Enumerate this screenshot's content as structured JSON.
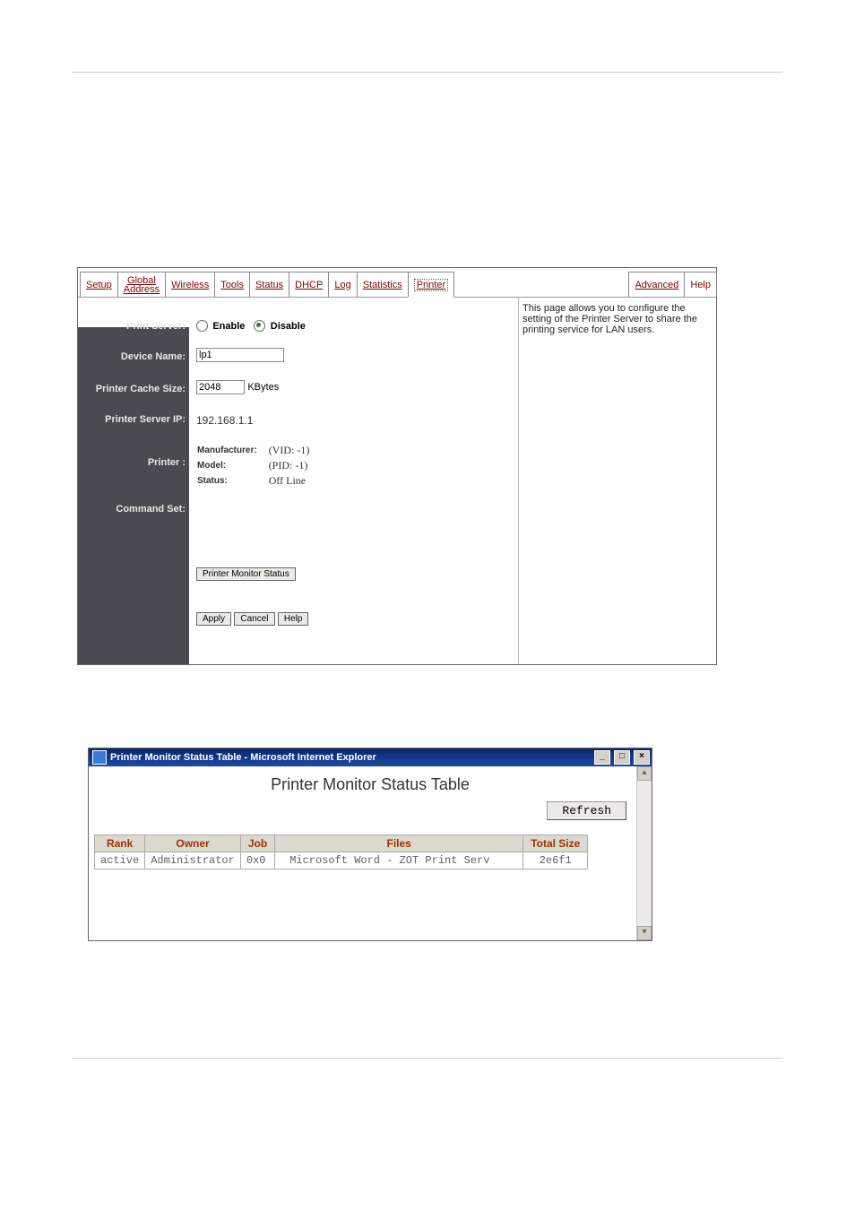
{
  "tabs": {
    "setup": "Setup",
    "global_address_top": "Global",
    "global_address_bot": "Address",
    "wireless": "Wireless",
    "tools": "Tools",
    "status": "Status",
    "dhcp": "DHCP",
    "log": "Log",
    "statistics": "Statistics",
    "printer": "Printer",
    "advanced": "Advanced",
    "help": "Help"
  },
  "side_help": "This page allows you to configure the setting of the Printer Server to share the printing service for LAN users.",
  "labels": {
    "print_server": "Print Server:",
    "device_name": "Device Name:",
    "printer_cache_size": "Printer Cache Size:",
    "printer_server_ip": "Printer Server IP:",
    "printer": "Printer :",
    "command_set": "Command Set:"
  },
  "values": {
    "enable": "Enable",
    "disable": "Disable",
    "device_name_val": "lp1",
    "cache_size_val": "2048",
    "cache_size_unit": "KBytes",
    "server_ip": "192.168.1.1",
    "manufacturer_label": "Manufacturer:",
    "manufacturer_val": "(VID: -1)",
    "model_label": "Model:",
    "model_val": "(PID: -1)",
    "status_label": "Status:",
    "status_val": "Off Line"
  },
  "buttons": {
    "printer_monitor_status": "Printer Monitor Status",
    "apply": "Apply",
    "cancel": "Cancel",
    "help": "Help"
  },
  "monitor": {
    "window_title": "Printer Monitor Status Table - Microsoft Internet Explorer",
    "page_title": "Printer Monitor Status Table",
    "refresh": "Refresh",
    "headers": {
      "rank": "Rank",
      "owner": "Owner",
      "job": "Job",
      "files": "Files",
      "total_size": "Total Size"
    },
    "row": {
      "rank": "active",
      "owner": "Administrator",
      "job": "0x0",
      "files": "Microsoft Word - ZOT Print Serv",
      "total_size": "2e6f1"
    }
  }
}
